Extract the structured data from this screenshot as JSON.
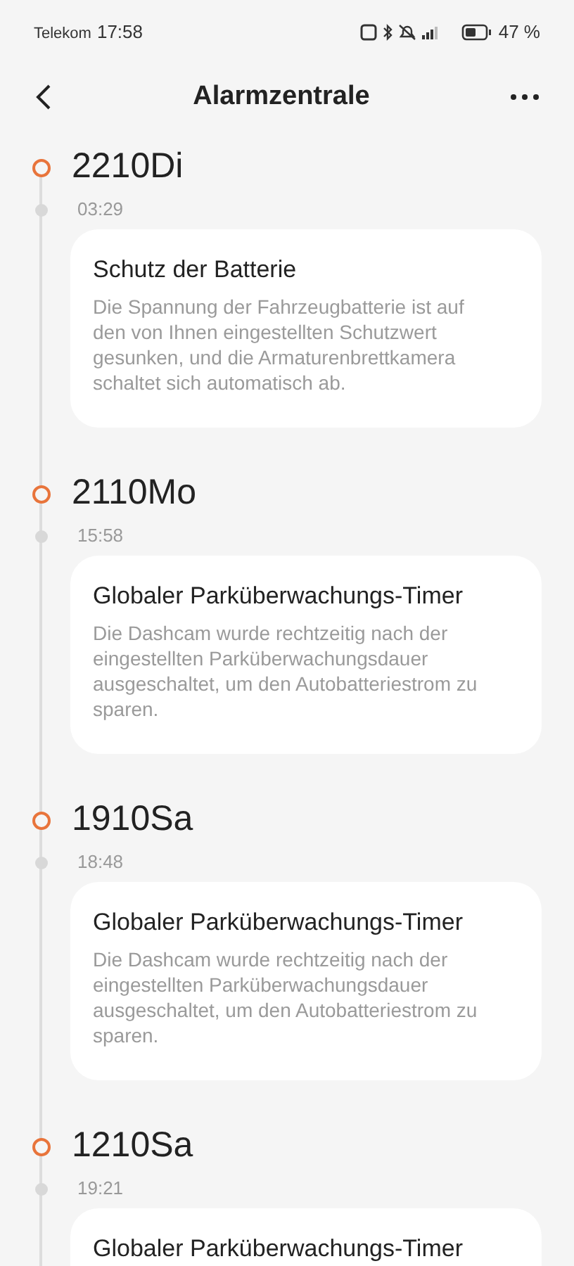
{
  "status_bar": {
    "carrier": "Telekom",
    "time": "17:58",
    "battery_text": "47 %"
  },
  "header": {
    "title": "Alarmzentrale"
  },
  "days": [
    {
      "date": "2210Di",
      "events": [
        {
          "time": "03:29",
          "title": "Schutz der Batterie",
          "description": "Die Spannung der Fahrzeugbatterie ist auf den von Ihnen eingestellten Schutzwert gesunken, und die Armaturenbrettkamera schaltet sich automatisch ab."
        }
      ]
    },
    {
      "date": "2110Mo",
      "events": [
        {
          "time": "15:58",
          "title": "Globaler Parküberwachungs-Timer",
          "description": "Die Dashcam wurde rechtzeitig nach der eingestellten Parküberwachungsdauer ausgeschaltet, um den Autobatteriestrom zu sparen."
        }
      ]
    },
    {
      "date": "1910Sa",
      "events": [
        {
          "time": "18:48",
          "title": "Globaler Parküberwachungs-Timer",
          "description": "Die Dashcam wurde rechtzeitig nach der eingestellten Parküberwachungsdauer ausgeschaltet, um den Autobatteriestrom zu sparen."
        }
      ]
    },
    {
      "date": "1210Sa",
      "events": [
        {
          "time": "19:21",
          "title": "Globaler Parküberwachungs-Timer"
        }
      ]
    }
  ]
}
